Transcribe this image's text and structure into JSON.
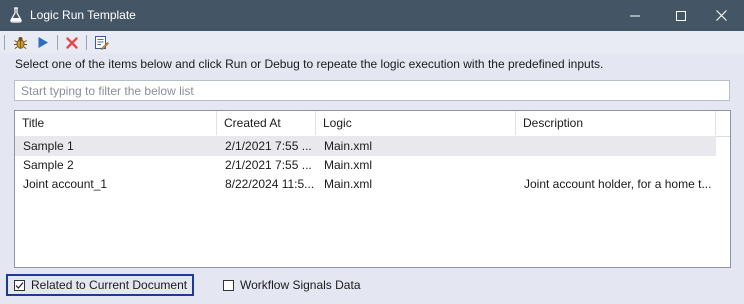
{
  "window": {
    "title": "Logic Run Template",
    "icon": "flask-icon",
    "controls": [
      "minimize-icon",
      "maximize-icon",
      "close-icon"
    ]
  },
  "toolbar": {
    "buttons": [
      {
        "name": "debug",
        "icon": "bug-icon"
      },
      {
        "name": "run",
        "icon": "play-icon"
      },
      {
        "name": "delete",
        "icon": "delete-x-icon"
      },
      {
        "name": "edit",
        "icon": "edit-document-icon"
      }
    ]
  },
  "instructions": "Select one of the items below and click Run or Debug to repeate the logic execution with the predefined inputs.",
  "filter": {
    "placeholder": "Start typing to filter the below list",
    "value": ""
  },
  "table": {
    "columns": [
      "Title",
      "Created At",
      "Logic",
      "Description"
    ],
    "rows": [
      {
        "title": "Sample 1",
        "created": "2/1/2021 7:55 ...",
        "logic": "Main.xml",
        "description": "",
        "selected": true
      },
      {
        "title": "Sample 2",
        "created": "2/1/2021 7:55 ...",
        "logic": "Main.xml",
        "description": "",
        "selected": false
      },
      {
        "title": "Joint account_1",
        "created": "8/22/2024 11:5...",
        "logic": "Main.xml",
        "description": "Joint account holder, for a home t...",
        "selected": false
      }
    ]
  },
  "options": {
    "related": {
      "label": "Related to Current Document",
      "checked": true
    },
    "workflow": {
      "label": "Workflow Signals Data",
      "checked": false
    }
  },
  "colors": {
    "titlebar": "#445566",
    "run_icon": "#2d6fbf",
    "delete_icon": "#e24b4b",
    "focus_border": "#1f3a93"
  }
}
